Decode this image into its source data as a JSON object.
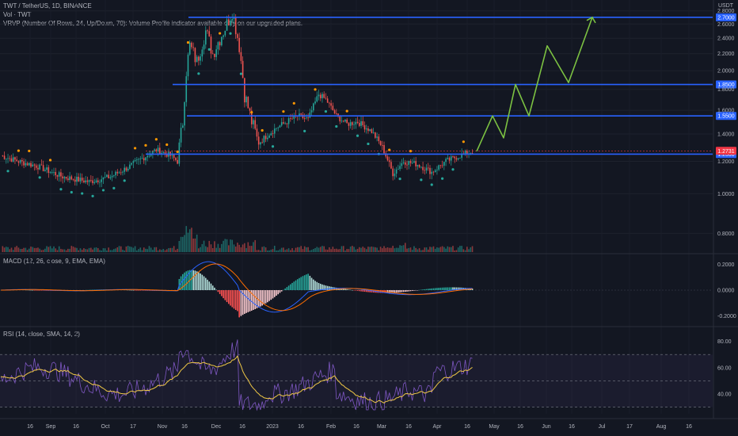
{
  "header": {
    "symbol_line": "TWT / TetherUS, 1D, BINANCE",
    "vol_line": "Vol · TWT",
    "vrvp_line": "VRVP (Number Of Rows, 24, Up/Down, 70): Volume Profile indicator available only on our upgraded plans.",
    "currency": "USDT"
  },
  "macd_legend": "MACD (12, 26, close, 9, EMA, EMA)",
  "rsi_legend": "RSI (14, close, SMA, 14, 2)",
  "colors": {
    "background": "#131722",
    "up": "#26a69a",
    "down": "#ef5350",
    "level_line": "#2962ff",
    "projection": "#7cc242",
    "macd_line": "#2962ff",
    "signal_line": "#ff6d00",
    "rsi_line": "#7e57c2",
    "rsi_ma": "#f0c846",
    "price_badge": "#f23645"
  },
  "chart_data": [
    {
      "type": "candlestick",
      "title": "TWT / TetherUS, 1D, BINANCE",
      "y_scale": "log",
      "ylim": [
        0.72,
        2.95
      ],
      "price_ticks": [
        "2.8000",
        "2.6000",
        "2.4000",
        "2.2000",
        "2.0000",
        "1.8000",
        "1.6000",
        "1.4000",
        "1.2000",
        "1.0000",
        "0.8000"
      ],
      "x_ticks": [
        "16",
        "Sep",
        "16",
        "Oct",
        "17",
        "Nov",
        "16",
        "Dec",
        "16",
        "2023",
        "16",
        "Feb",
        "16",
        "Mar",
        "16",
        "Apr",
        "16",
        "May",
        "16",
        "Jun",
        "16",
        "Jul",
        "17",
        "Aug",
        "16"
      ],
      "horizontal_levels": [
        {
          "price": 2.7,
          "label": "2.7000"
        },
        {
          "price": 1.85,
          "label": "1.8500"
        },
        {
          "price": 1.55,
          "label": "1.5500"
        },
        {
          "price": 1.25,
          "label": "1.2500"
        }
      ],
      "last_price": {
        "price": 1.273,
        "label": "1.2731"
      },
      "projection_path": [
        1.27,
        1.55,
        1.37,
        1.85,
        1.55,
        2.3,
        1.87,
        2.7
      ]
    },
    {
      "type": "line",
      "title": "MACD (12, 26, close, 9, EMA, EMA)",
      "ylim": [
        -0.27,
        0.27
      ],
      "ticks": [
        "0.2000",
        "0.0000",
        "-0.2000"
      ]
    },
    {
      "type": "line",
      "title": "RSI (14, close, SMA, 14, 2)",
      "ylim": [
        25,
        90
      ],
      "ticks": [
        "80.00",
        "60.00",
        "40.00"
      ],
      "bands": [
        30,
        50,
        70
      ]
    }
  ]
}
